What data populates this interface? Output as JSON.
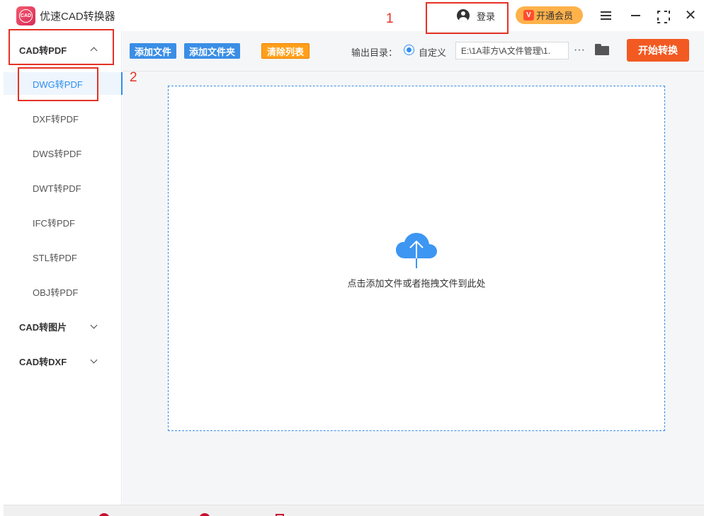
{
  "app": {
    "logo_text": "CAD",
    "title": "优速CAD转换器"
  },
  "titlebar": {
    "login_label": "登录",
    "vip_label": "开通会员",
    "vip_icon_text": "V"
  },
  "sidebar": {
    "groups": [
      {
        "label": "CAD转PDF",
        "expanded": true,
        "items": [
          {
            "label": "DWG转PDF",
            "active": true
          },
          {
            "label": "DXF转PDF"
          },
          {
            "label": "DWS转PDF"
          },
          {
            "label": "DWT转PDF"
          },
          {
            "label": "IFC转PDF"
          },
          {
            "label": "STL转PDF"
          },
          {
            "label": "OBJ转PDF"
          }
        ]
      },
      {
        "label": "CAD转图片",
        "expanded": false
      },
      {
        "label": "CAD转DXF",
        "expanded": false
      }
    ]
  },
  "toolbar": {
    "add_file": "添加文件",
    "add_folder": "添加文件夹",
    "clear_list": "清除列表",
    "output_label": "输出目录：",
    "custom_option": "自定义",
    "output_path": "E:\\1A菲方\\A文件管理\\1.",
    "more": "···",
    "start": "开始转换"
  },
  "dropzone": {
    "hint": "点击添加文件或者拖拽文件到此处"
  },
  "annotations": {
    "step1": "1",
    "step2": "2"
  },
  "colors": {
    "accent": "#2e8ef0",
    "start_button": "#f25a22",
    "clear_button": "#ff9f1a",
    "vip_button": "#ffb14a",
    "annotation": "#e53224"
  }
}
